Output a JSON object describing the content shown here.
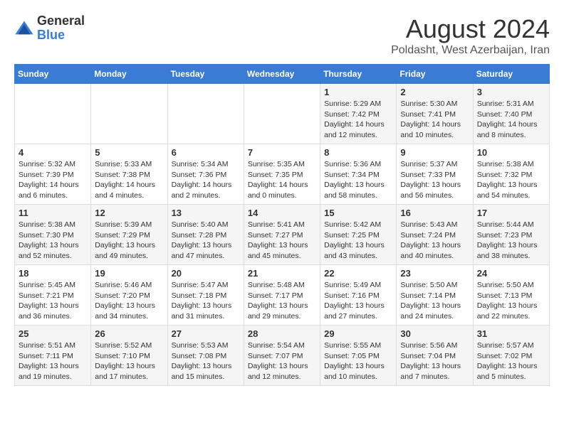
{
  "logo": {
    "general": "General",
    "blue": "Blue"
  },
  "title": "August 2024",
  "subtitle": "Poldasht, West Azerbaijan, Iran",
  "headers": [
    "Sunday",
    "Monday",
    "Tuesday",
    "Wednesday",
    "Thursday",
    "Friday",
    "Saturday"
  ],
  "weeks": [
    [
      {
        "day": "",
        "content": ""
      },
      {
        "day": "",
        "content": ""
      },
      {
        "day": "",
        "content": ""
      },
      {
        "day": "",
        "content": ""
      },
      {
        "day": "1",
        "content": "Sunrise: 5:29 AM\nSunset: 7:42 PM\nDaylight: 14 hours\nand 12 minutes."
      },
      {
        "day": "2",
        "content": "Sunrise: 5:30 AM\nSunset: 7:41 PM\nDaylight: 14 hours\nand 10 minutes."
      },
      {
        "day": "3",
        "content": "Sunrise: 5:31 AM\nSunset: 7:40 PM\nDaylight: 14 hours\nand 8 minutes."
      }
    ],
    [
      {
        "day": "4",
        "content": "Sunrise: 5:32 AM\nSunset: 7:39 PM\nDaylight: 14 hours\nand 6 minutes."
      },
      {
        "day": "5",
        "content": "Sunrise: 5:33 AM\nSunset: 7:38 PM\nDaylight: 14 hours\nand 4 minutes."
      },
      {
        "day": "6",
        "content": "Sunrise: 5:34 AM\nSunset: 7:36 PM\nDaylight: 14 hours\nand 2 minutes."
      },
      {
        "day": "7",
        "content": "Sunrise: 5:35 AM\nSunset: 7:35 PM\nDaylight: 14 hours\nand 0 minutes."
      },
      {
        "day": "8",
        "content": "Sunrise: 5:36 AM\nSunset: 7:34 PM\nDaylight: 13 hours\nand 58 minutes."
      },
      {
        "day": "9",
        "content": "Sunrise: 5:37 AM\nSunset: 7:33 PM\nDaylight: 13 hours\nand 56 minutes."
      },
      {
        "day": "10",
        "content": "Sunrise: 5:38 AM\nSunset: 7:32 PM\nDaylight: 13 hours\nand 54 minutes."
      }
    ],
    [
      {
        "day": "11",
        "content": "Sunrise: 5:38 AM\nSunset: 7:30 PM\nDaylight: 13 hours\nand 52 minutes."
      },
      {
        "day": "12",
        "content": "Sunrise: 5:39 AM\nSunset: 7:29 PM\nDaylight: 13 hours\nand 49 minutes."
      },
      {
        "day": "13",
        "content": "Sunrise: 5:40 AM\nSunset: 7:28 PM\nDaylight: 13 hours\nand 47 minutes."
      },
      {
        "day": "14",
        "content": "Sunrise: 5:41 AM\nSunset: 7:27 PM\nDaylight: 13 hours\nand 45 minutes."
      },
      {
        "day": "15",
        "content": "Sunrise: 5:42 AM\nSunset: 7:25 PM\nDaylight: 13 hours\nand 43 minutes."
      },
      {
        "day": "16",
        "content": "Sunrise: 5:43 AM\nSunset: 7:24 PM\nDaylight: 13 hours\nand 40 minutes."
      },
      {
        "day": "17",
        "content": "Sunrise: 5:44 AM\nSunset: 7:23 PM\nDaylight: 13 hours\nand 38 minutes."
      }
    ],
    [
      {
        "day": "18",
        "content": "Sunrise: 5:45 AM\nSunset: 7:21 PM\nDaylight: 13 hours\nand 36 minutes."
      },
      {
        "day": "19",
        "content": "Sunrise: 5:46 AM\nSunset: 7:20 PM\nDaylight: 13 hours\nand 34 minutes."
      },
      {
        "day": "20",
        "content": "Sunrise: 5:47 AM\nSunset: 7:18 PM\nDaylight: 13 hours\nand 31 minutes."
      },
      {
        "day": "21",
        "content": "Sunrise: 5:48 AM\nSunset: 7:17 PM\nDaylight: 13 hours\nand 29 minutes."
      },
      {
        "day": "22",
        "content": "Sunrise: 5:49 AM\nSunset: 7:16 PM\nDaylight: 13 hours\nand 27 minutes."
      },
      {
        "day": "23",
        "content": "Sunrise: 5:50 AM\nSunset: 7:14 PM\nDaylight: 13 hours\nand 24 minutes."
      },
      {
        "day": "24",
        "content": "Sunrise: 5:50 AM\nSunset: 7:13 PM\nDaylight: 13 hours\nand 22 minutes."
      }
    ],
    [
      {
        "day": "25",
        "content": "Sunrise: 5:51 AM\nSunset: 7:11 PM\nDaylight: 13 hours\nand 19 minutes."
      },
      {
        "day": "26",
        "content": "Sunrise: 5:52 AM\nSunset: 7:10 PM\nDaylight: 13 hours\nand 17 minutes."
      },
      {
        "day": "27",
        "content": "Sunrise: 5:53 AM\nSunset: 7:08 PM\nDaylight: 13 hours\nand 15 minutes."
      },
      {
        "day": "28",
        "content": "Sunrise: 5:54 AM\nSunset: 7:07 PM\nDaylight: 13 hours\nand 12 minutes."
      },
      {
        "day": "29",
        "content": "Sunrise: 5:55 AM\nSunset: 7:05 PM\nDaylight: 13 hours\nand 10 minutes."
      },
      {
        "day": "30",
        "content": "Sunrise: 5:56 AM\nSunset: 7:04 PM\nDaylight: 13 hours\nand 7 minutes."
      },
      {
        "day": "31",
        "content": "Sunrise: 5:57 AM\nSunset: 7:02 PM\nDaylight: 13 hours\nand 5 minutes."
      }
    ]
  ]
}
